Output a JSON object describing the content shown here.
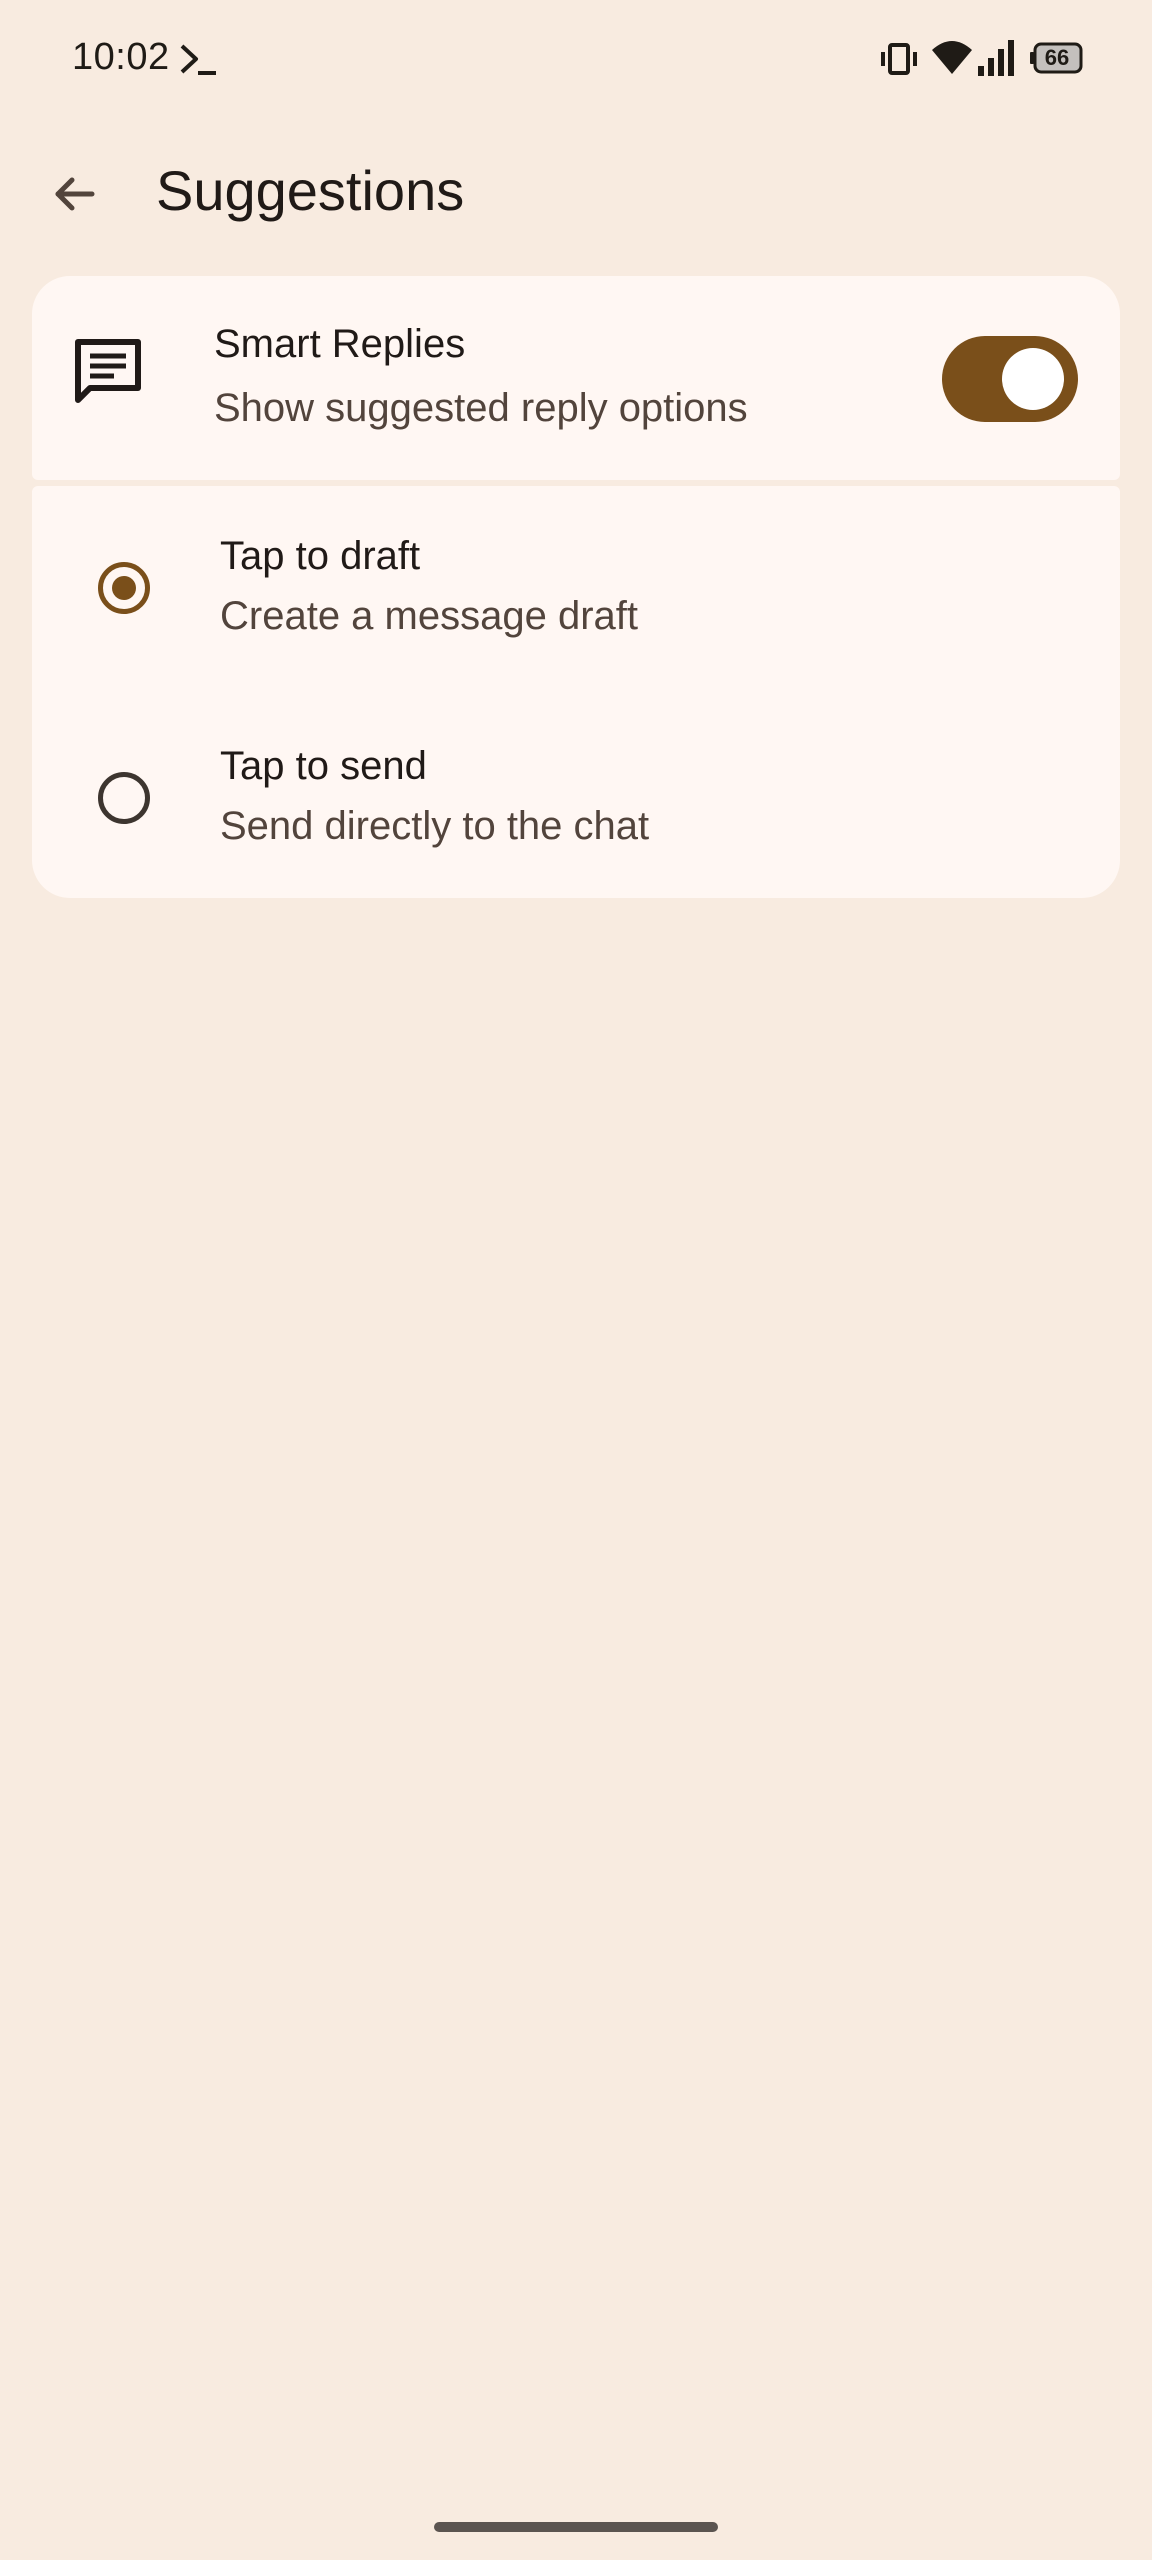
{
  "status_bar": {
    "time": "10:02",
    "battery_level": "66",
    "icons": [
      "terminal-icon",
      "vibrate-icon",
      "wifi-icon",
      "signal-icon",
      "battery-icon"
    ]
  },
  "app_bar": {
    "title": "Suggestions",
    "back_icon": "arrow-back-icon"
  },
  "smart_replies": {
    "icon": "message-icon",
    "title": "Smart Replies",
    "subtitle": "Show suggested reply options",
    "enabled": true
  },
  "reply_modes": [
    {
      "title": "Tap to draft",
      "subtitle": "Create a message draft",
      "selected": true
    },
    {
      "title": "Tap to send",
      "subtitle": "Send directly to the chat",
      "selected": false
    }
  ],
  "colors": {
    "background": "#f8ebe0",
    "card": "#fff7f3",
    "accent": "#7a4f1a",
    "text_primary": "#201a17",
    "text_secondary": "#52443c"
  }
}
